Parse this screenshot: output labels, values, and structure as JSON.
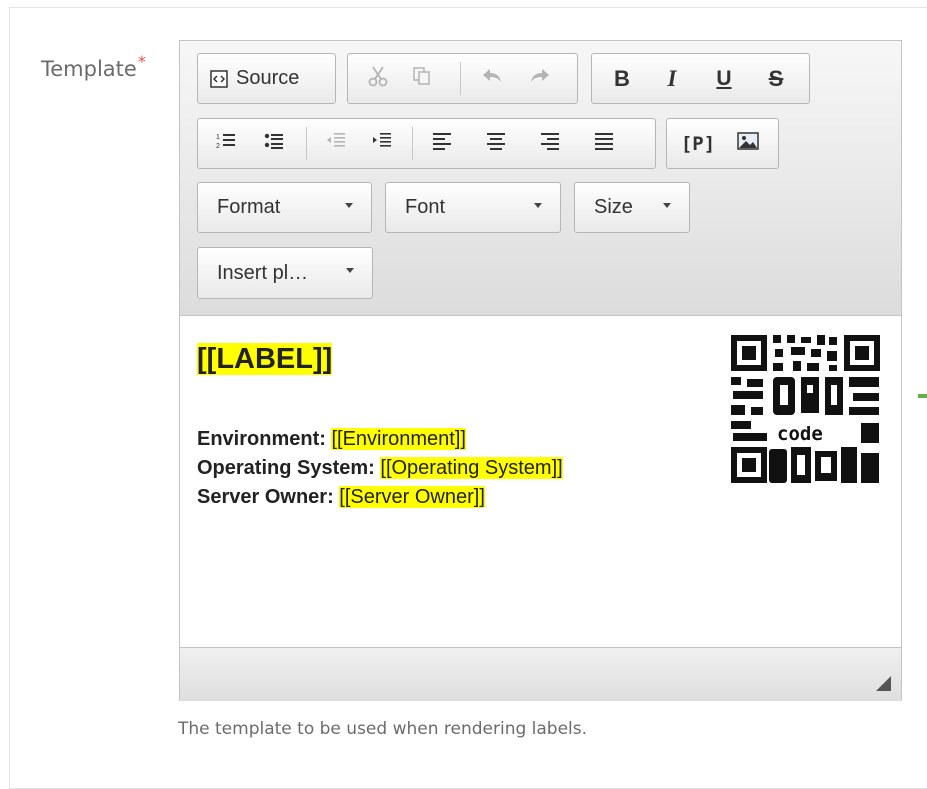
{
  "field": {
    "label": "Template",
    "required_marker": "*",
    "help_text": "The template to be used when rendering labels."
  },
  "toolbar": {
    "source_label": "Source",
    "format_label": "Format",
    "font_label": "Font",
    "size_label": "Size",
    "insert_placeholder_label": "Insert pl…",
    "icons": [
      "source-icon",
      "cut-icon",
      "copy-icon",
      "undo-icon",
      "redo-icon",
      "bold-icon",
      "italic-icon",
      "underline-icon",
      "strikethrough-icon",
      "numbered-list-icon",
      "bulleted-list-icon",
      "outdent-icon",
      "indent-icon",
      "align-left-icon",
      "align-center-icon",
      "align-right-icon",
      "justify-icon",
      "placeholder-icon",
      "image-icon"
    ],
    "bold_glyph": "B",
    "italic_glyph": "I",
    "underline_glyph": "U",
    "strike_glyph": "S",
    "placeholder_glyph": "[P]"
  },
  "content": {
    "title": "[[LABEL]]",
    "lines": [
      {
        "label": "Environment:",
        "value": "[[Environment]]"
      },
      {
        "label": "Operating System:",
        "value": "[[Operating System]]"
      },
      {
        "label": "Server Owner:",
        "value": "[[Server Owner]]"
      }
    ],
    "qr_caption": "code",
    "highlight_color": "#ffff00"
  }
}
